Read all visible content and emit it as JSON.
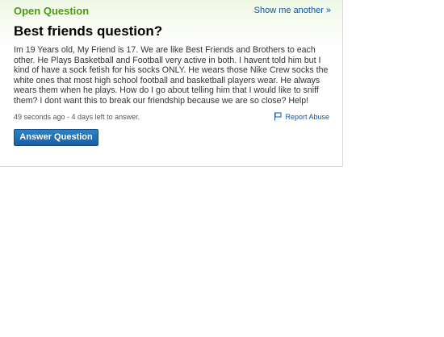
{
  "header": {
    "open_question": "Open Question",
    "show_another": "Show me another",
    "show_another_chevron": "»"
  },
  "question": {
    "title": "Best friends question?",
    "body": "Im 19 Years old, My Friend is 17. We are like Best Friends and Brothers to each other. He Plays Basketball and Football very active in both. I havent told him but I kind of have a sock fetish for his socks ONLY. He wears those Nike Crew socks the white ones that most high school football and basketball players wear. He always wears them when he plays. How do I go about telling him that I would like to sniff them? I dont want this to break our friendship because we are so close? Help!",
    "meta": "49 seconds ago - 4 days left to answer.",
    "report_label": "Report Abuse",
    "report_icon": "flag-icon"
  },
  "actions": {
    "answer_label": "Answer Question"
  },
  "colors": {
    "open_question": "#4a9a11",
    "link": "#0e55a6",
    "button": "#1a5fa3"
  }
}
